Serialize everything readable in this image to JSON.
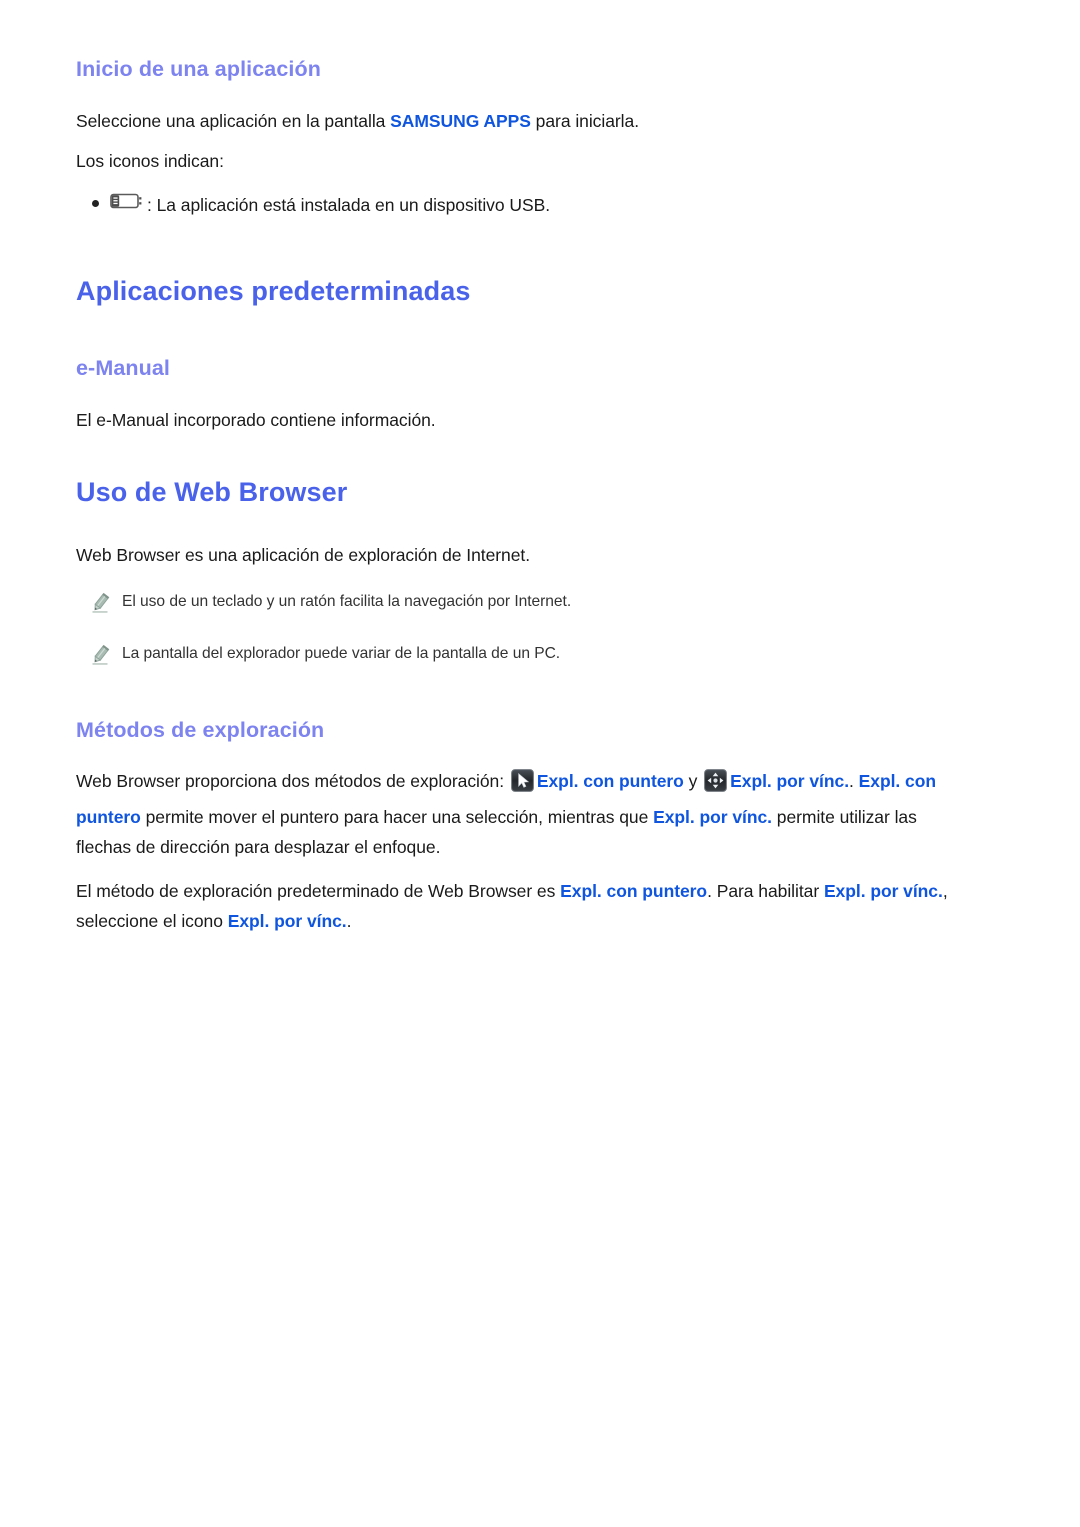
{
  "colors": {
    "h1": "#4a62ea",
    "h2": "#7d83ef",
    "highlight": "#0f55de",
    "body": "#1a1a1a",
    "note": "#333333",
    "pencil": "#8ea39a",
    "icon_tile": "#2b2f33"
  },
  "sections": {
    "app_start": {
      "heading": "Inicio de una aplicación",
      "paragraph_before": "Seleccione una aplicación en la pantalla ",
      "highlight": "SAMSUNG APPS",
      "paragraph_after": " para iniciarla.",
      "paragraph_line2": "Los iconos indican:",
      "bullet": {
        "icon_name": "usb-device-icon",
        "text": ": La aplicación está instalada en un dispositivo USB."
      }
    },
    "default_apps": {
      "heading": "Aplicaciones predeterminadas",
      "sub_heading": "e-Manual",
      "paragraph": "El e-Manual incorporado contiene información."
    },
    "web_browser": {
      "heading": "Uso de Web Browser",
      "paragraph": "Web Browser es una aplicación de exploración de Internet.",
      "notes": [
        {
          "icon_name": "pencil-icon",
          "text": "El uso de un teclado y un ratón facilita la navegación por Internet."
        },
        {
          "icon_name": "pencil-icon",
          "text": "La pantalla del explorador puede variar de la pantalla de un PC."
        }
      ]
    },
    "browse_methods": {
      "heading": "Métodos de exploración",
      "para1": {
        "t1": "Web Browser proporciona dos métodos de exploración: ",
        "icon1_name": "pointer-cursor-icon",
        "b1": "Expl. con puntero",
        "t2": " y ",
        "icon2_name": "dpad-arrows-icon",
        "b2": "Expl. por vínc.",
        "t3": ". ",
        "b3": "Expl. con puntero",
        "t4": " permite mover el puntero para hacer una selección, mientras que ",
        "b4": "Expl. por vínc.",
        "t5": " permite utilizar las flechas de dirección para desplazar el enfoque."
      },
      "para2": {
        "t1": "El método de exploración predeterminado de Web Browser es ",
        "b1": "Expl. con puntero",
        "t2": ". Para habilitar ",
        "b2": "Expl. por vínc.",
        "t3": ", seleccione el icono ",
        "b3": "Expl. por vínc.",
        "t4": "."
      }
    }
  }
}
